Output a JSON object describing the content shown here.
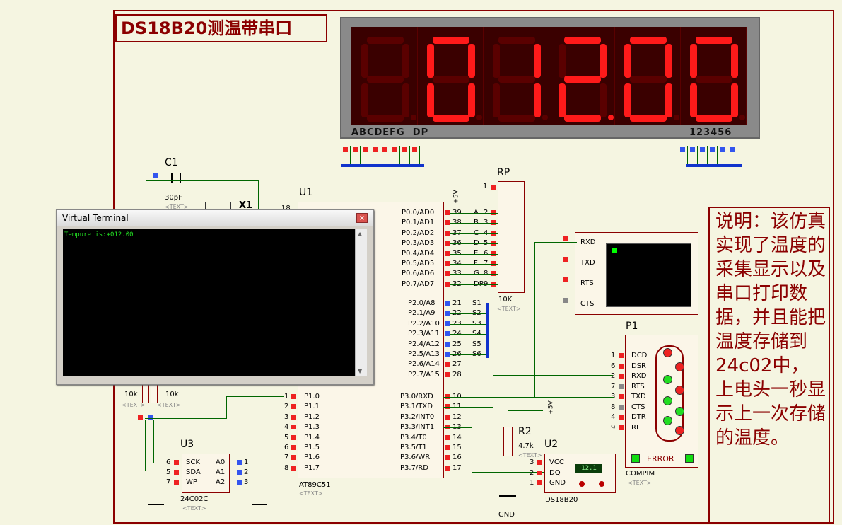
{
  "title": "DS18B20测温带串口",
  "display": {
    "digits": [
      "",
      "0",
      "1",
      "2",
      "0",
      "0"
    ],
    "dp_after_index": 3,
    "seg_label": "ABCDEFG  DP",
    "digit_label": "123456",
    "colors": {
      "on": "#ff1a1a",
      "off": "#5a0000",
      "bg": "#3a0000"
    }
  },
  "components": {
    "c1": {
      "ref": "C1",
      "value": "30pF",
      "text": "<TEXT>"
    },
    "x1": {
      "ref": "X1"
    },
    "u1": {
      "ref": "U1",
      "part": "AT89C51",
      "text": "<TEXT>"
    },
    "rp": {
      "ref": "RP",
      "value": "10K",
      "text": "<TEXT>",
      "power": "+5V"
    },
    "r1r": {
      "value1": "10k",
      "value2": "10k",
      "text1": "<TEXT>",
      "text2": "<TEXT>"
    },
    "u3": {
      "ref": "U3",
      "part": "24C02C",
      "text": "<TEXT>",
      "pins_left": [
        {
          "n": "6",
          "name": "SCK"
        },
        {
          "n": "5",
          "name": "SDA"
        },
        {
          "n": "7",
          "name": "WP"
        }
      ],
      "pins_right": [
        {
          "n": "1",
          "name": "A0"
        },
        {
          "n": "2",
          "name": "A1"
        },
        {
          "n": "3",
          "name": "A2"
        }
      ]
    },
    "r2": {
      "ref": "R2",
      "value": "4.7k",
      "text": "<TEXT>",
      "power": "+5V"
    },
    "u2": {
      "ref": "U2",
      "part": "DS18B20",
      "reading": "12.1",
      "pins": [
        {
          "n": "3",
          "name": "VCC"
        },
        {
          "n": "2",
          "name": "DQ"
        },
        {
          "n": "1",
          "name": "GND"
        }
      ]
    },
    "p1": {
      "ref": "P1",
      "part": "COMPIM",
      "text": "<TEXT>",
      "error": "ERROR",
      "pins": [
        {
          "n": "1",
          "name": "DCD"
        },
        {
          "n": "6",
          "name": "DSR"
        },
        {
          "n": "2",
          "name": "RXD"
        },
        {
          "n": "7",
          "name": "RTS"
        },
        {
          "n": "3",
          "name": "TXD"
        },
        {
          "n": "8",
          "name": "CTS"
        },
        {
          "n": "4",
          "name": "DTR"
        },
        {
          "n": "9",
          "name": "RI"
        }
      ]
    },
    "term": {
      "pins": [
        "RXD",
        "TXD",
        "RTS",
        "CTS"
      ]
    },
    "gnd": "GND"
  },
  "u1_pins": {
    "p0": [
      {
        "n": "39",
        "name": "P0.0/AD0"
      },
      {
        "n": "38",
        "name": "P0.1/AD1"
      },
      {
        "n": "37",
        "name": "P0.2/AD2"
      },
      {
        "n": "36",
        "name": "P0.3/AD3"
      },
      {
        "n": "35",
        "name": "P0.4/AD4"
      },
      {
        "n": "34",
        "name": "P0.5/AD5"
      },
      {
        "n": "33",
        "name": "P0.6/AD6"
      },
      {
        "n": "32",
        "name": "P0.7/AD7"
      }
    ],
    "p0_nets": [
      "A",
      "B",
      "C",
      "D",
      "E",
      "F",
      "G",
      "DP"
    ],
    "p0_rp": [
      "2",
      "3",
      "4",
      "5",
      "6",
      "7",
      "8",
      "9"
    ],
    "p2": [
      {
        "n": "21",
        "name": "P2.0/A8"
      },
      {
        "n": "22",
        "name": "P2.1/A9"
      },
      {
        "n": "23",
        "name": "P2.2/A10"
      },
      {
        "n": "24",
        "name": "P2.3/A11"
      },
      {
        "n": "25",
        "name": "P2.4/A12"
      },
      {
        "n": "26",
        "name": "P2.5/A13"
      },
      {
        "n": "27",
        "name": "P2.6/A14"
      },
      {
        "n": "28",
        "name": "P2.7/A15"
      }
    ],
    "p2_nets": [
      "S1",
      "S2",
      "S3",
      "S4",
      "S5",
      "S6"
    ],
    "p1": [
      {
        "n": "1",
        "name": "P1.0"
      },
      {
        "n": "2",
        "name": "P1.1"
      },
      {
        "n": "3",
        "name": "P1.2"
      },
      {
        "n": "4",
        "name": "P1.3"
      },
      {
        "n": "5",
        "name": "P1.4"
      },
      {
        "n": "6",
        "name": "P1.5"
      },
      {
        "n": "7",
        "name": "P1.6"
      },
      {
        "n": "8",
        "name": "P1.7"
      }
    ],
    "p3": [
      {
        "n": "10",
        "name": "P3.0/RXD"
      },
      {
        "n": "11",
        "name": "P3.1/TXD"
      },
      {
        "n": "12",
        "name": "P3.2/INT0"
      },
      {
        "n": "13",
        "name": "P3.3/INT1"
      },
      {
        "n": "14",
        "name": "P3.4/T0"
      },
      {
        "n": "15",
        "name": "P3.5/T1"
      },
      {
        "n": "16",
        "name": "P3.6/WR"
      },
      {
        "n": "17",
        "name": "P3.7/RD"
      }
    ],
    "top_pin": "18"
  },
  "virtual_terminal": {
    "title": "Virtual Terminal",
    "close": "×",
    "output": "Tempure is:+012.00"
  },
  "description": "说明：该仿真实现了温度的采集显示以及串口打印数据，并且能把温度存储到24c02中，上电头一秒显示上一次存储的温度。"
}
